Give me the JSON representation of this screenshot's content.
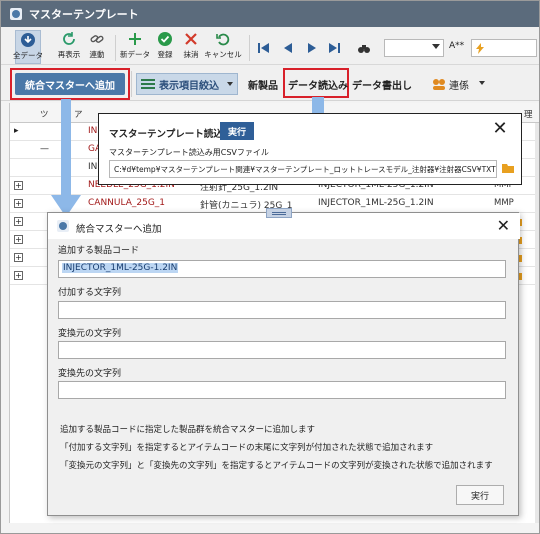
{
  "window": {
    "title": "マスターテンプレート"
  },
  "toolbar1": {
    "buttons": [
      {
        "label": "全データ",
        "icon": "download-icon"
      },
      {
        "label": "再表示",
        "icon": "refresh-icon"
      },
      {
        "label": "連動",
        "icon": "link-icon"
      },
      {
        "label": "新データ",
        "icon": "plus-icon"
      },
      {
        "label": "登録",
        "icon": "check-icon"
      },
      {
        "label": "抹消",
        "icon": "x-icon"
      },
      {
        "label": "キャンセル",
        "icon": "undo-icon"
      }
    ],
    "font_label": "A**"
  },
  "toolbar2": {
    "add_master": "統合マスターへ追加",
    "filter_items": "表示項目絞込",
    "new_product": "新製品",
    "data_read": "データ読込み",
    "data_write": "データ書出し",
    "link": "連係"
  },
  "grid": {
    "headers": [
      "ツ",
      "ア",
      "理"
    ],
    "rows": [
      {
        "indicator": "▸",
        "code": "IN",
        "c2": "",
        "c3": "",
        "c4": ""
      },
      {
        "dash": "—",
        "code": "GA",
        "c2": "",
        "c3": "",
        "c4": ""
      },
      {
        "code": "IN",
        "c2": "",
        "c3": "",
        "c4": ""
      },
      {
        "expand": "+",
        "code": "NEEDLE_25G_1.2IN",
        "c2": "注射針_25G_1.2IN",
        "c3": "INJECTOR_1ML-25G_1.2IN",
        "c4": "MMP"
      },
      {
        "expand": "+",
        "code": "CANNULA_25G_1",
        "c2": "針管(カニュラ) 25G_1",
        "c3": "INJECTOR_1ML-25G_1.2IN",
        "c4": "MMP"
      }
    ],
    "right_col": [
      "MMP",
      "MMP",
      "MMP",
      "MMP",
      "MMP",
      "MMP",
      "MMP",
      "MMP"
    ]
  },
  "read_popup": {
    "title": "マスターテンプレート読込み",
    "run": "実行",
    "close": "✕",
    "csv_label": "マスターテンプレート読込み用CSVファイル",
    "csv_path": "C:¥d¥temp¥マスターテンプレート関連¥マスターテンプレート_ロットトレースモデル_注射器¥注射器CSV¥TXTMPL.csv"
  },
  "dialog": {
    "title": "統合マスターへ追加",
    "close": "✕",
    "product_code_label": "追加する製品コード",
    "product_code_value": "INJECTOR_1ML-25G-1.2IN",
    "append_label": "付加する文字列",
    "append_value": "",
    "from_label": "変換元の文字列",
    "from_value": "",
    "to_label": "変換先の文字列",
    "to_value": "",
    "desc1": "追加する製品コードに指定した製品群を統合マスターに追加します",
    "desc2": "「付加する文字列」を指定するとアイテムコードの末尾に文字列が付加された状態で追加されます",
    "desc3": "「変換元の文字列」と「変換先の文字列」を指定するとアイテムコードの文字列が変換された状態で追加されます",
    "exec": "実行"
  },
  "colors": {
    "titlebar": "#5b6b7c",
    "accent": "#4a78a8",
    "highlight": "#d8202a",
    "arrow": "#8db8e8"
  }
}
